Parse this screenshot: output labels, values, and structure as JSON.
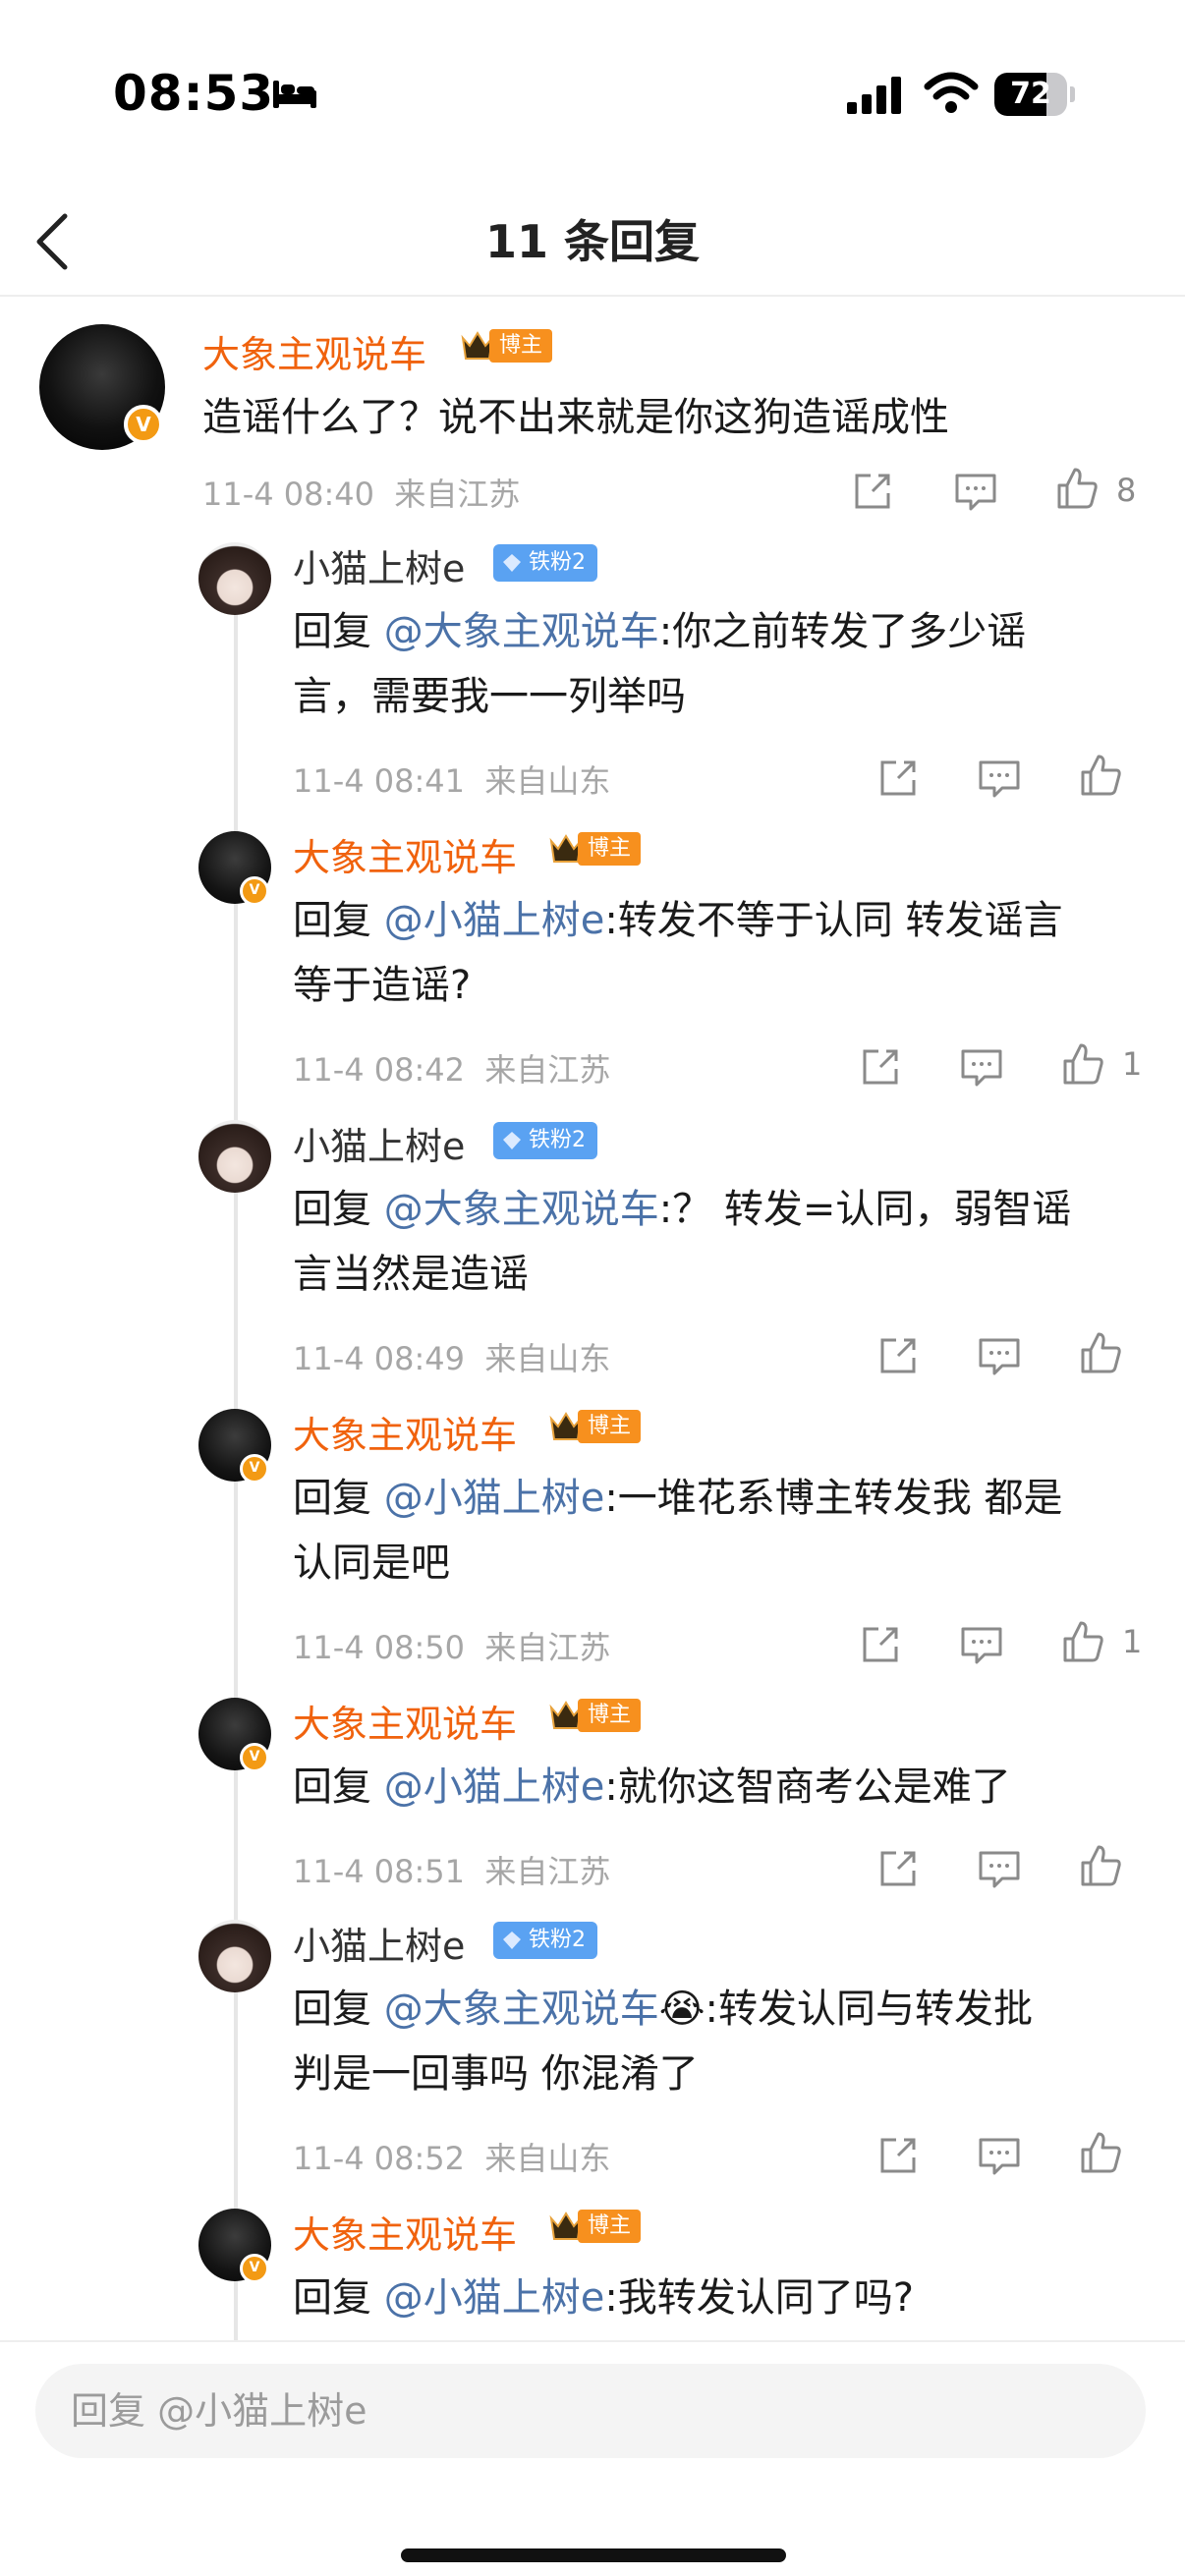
{
  "status": {
    "time": "08:53",
    "battery": "72",
    "battery_level": 0.72
  },
  "nav": {
    "title": "11 条回复"
  },
  "main_comment": {
    "user": "大象主观说车",
    "badge": "博主",
    "text": "造谣什么了？说不出来就是你这狗造谣成性",
    "time": "11-4 08:40",
    "location": "来自江苏",
    "likes": "8"
  },
  "replies": [
    {
      "user": "小猫上树e",
      "badge": "铁粉2",
      "prefix": "回复",
      "mention": "@大象主观说车",
      "text": ":你之前转发了多少谣言，需要我一一列举吗",
      "line1": ":你之前转发了多少谣",
      "line2": "言，需要我一一列举吗",
      "time": "11-4 08:41",
      "location": "来自山东",
      "likes": ""
    },
    {
      "user": "大象主观说车",
      "badge": "博主",
      "prefix": "回复",
      "mention": "@小猫上树e",
      "line1": ":转发不等于认同 转发谣言",
      "line2": "等于造谣?",
      "time": "11-4 08:42",
      "location": "来自江苏",
      "likes": "1"
    },
    {
      "user": "小猫上树e",
      "badge": "铁粉2",
      "prefix": "回复",
      "mention": "@大象主观说车",
      "line1": ":？ 转发=认同，弱智谣",
      "line2": "言当然是造谣",
      "time": "11-4 08:49",
      "location": "来自山东",
      "likes": ""
    },
    {
      "user": "大象主观说车",
      "badge": "博主",
      "prefix": "回复",
      "mention": "@小猫上树e",
      "line1": ":一堆花系博主转发我 都是",
      "line2": "认同是吧",
      "time": "11-4 08:50",
      "location": "来自江苏",
      "likes": "1"
    },
    {
      "user": "大象主观说车",
      "badge": "博主",
      "prefix": "回复",
      "mention": "@小猫上树e",
      "line1": ":就你这智商考公是难了",
      "line2": "",
      "time": "11-4 08:51",
      "location": "来自江苏",
      "likes": ""
    },
    {
      "user": "小猫上树e",
      "badge": "铁粉2",
      "prefix": "回复",
      "mention": "@大象主观说车",
      "line1": ":转发认同与转发批",
      "line2": "判是一回事吗  你混淆了",
      "emoji": "😭",
      "time": "11-4 08:52",
      "location": "来自山东",
      "likes": ""
    },
    {
      "user": "大象主观说车",
      "badge": "博主",
      "prefix": "回复",
      "mention": "@小猫上树e",
      "line1": ":我转发认同了吗?",
      "line2": "",
      "time": "",
      "location": "",
      "likes": ""
    }
  ],
  "input": {
    "placeholder": "回复 @小猫上树e"
  },
  "icons": [
    "back-arrow-icon",
    "share-icon",
    "comment-icon",
    "like-icon",
    "crown-icon",
    "diamond-icon",
    "verified-icon",
    "bed-icon",
    "signal-icon",
    "wifi-icon",
    "battery-icon"
  ]
}
